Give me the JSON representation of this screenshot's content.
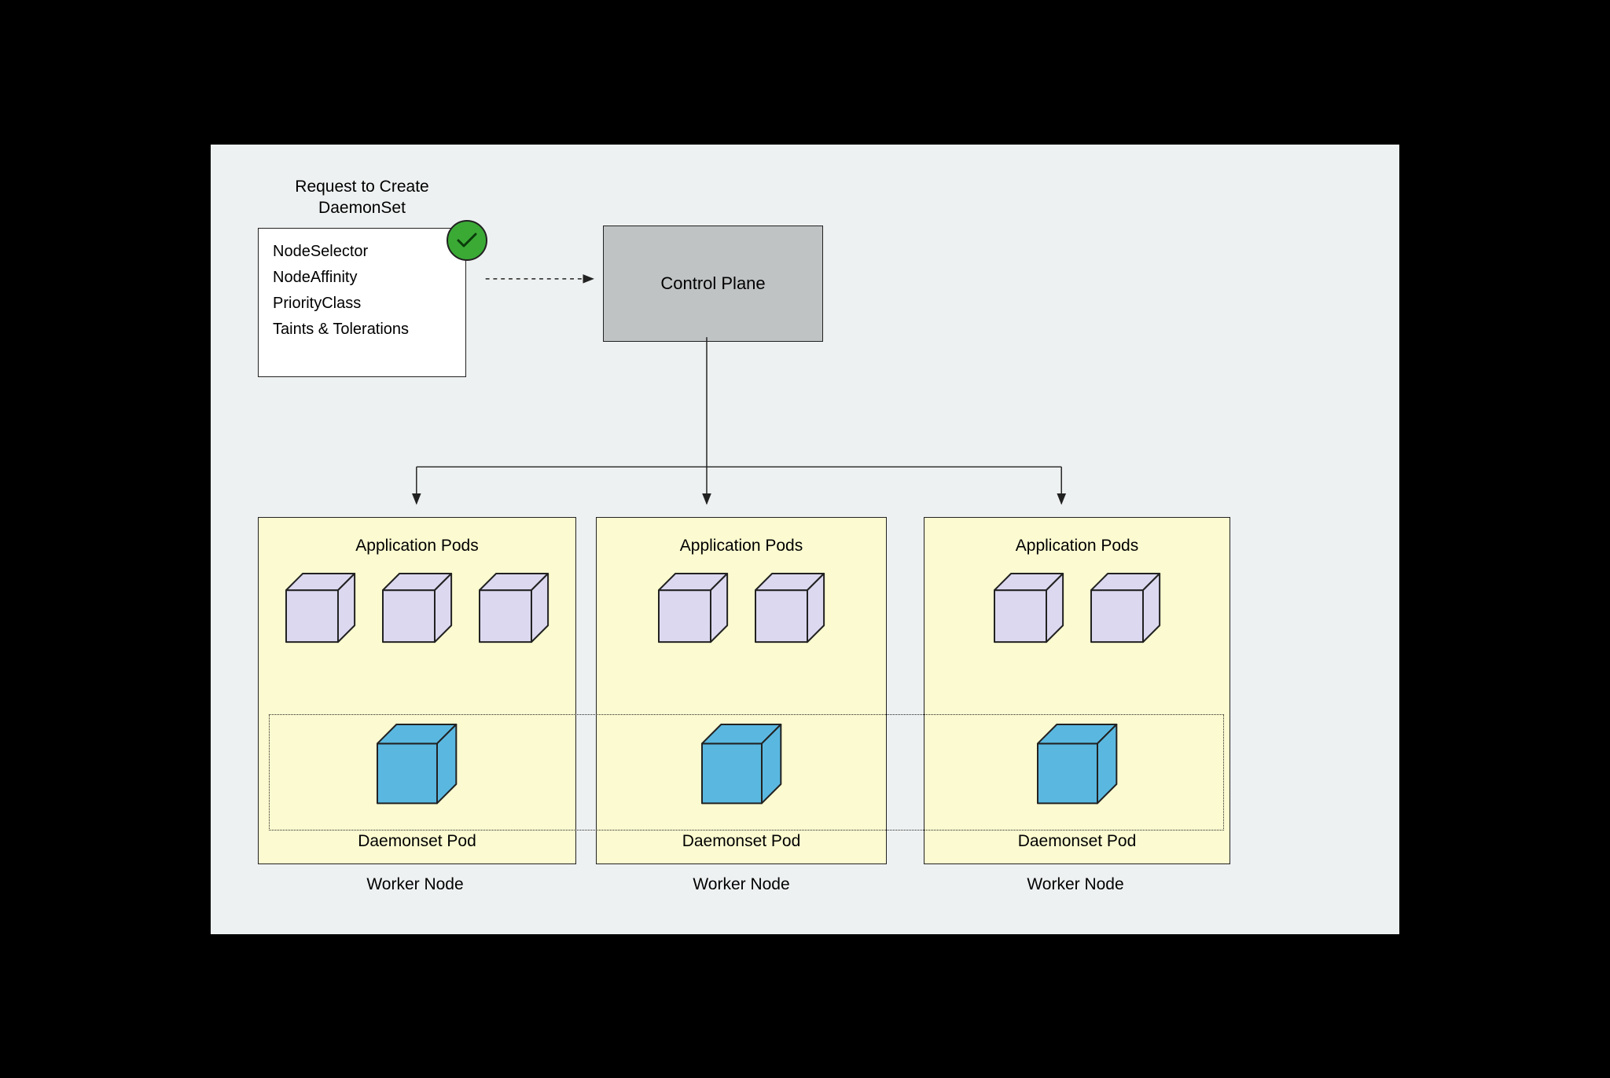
{
  "request": {
    "title": "Request to Create\nDaemonSet",
    "items": [
      "NodeSelector",
      "NodeAffinity",
      "PriorityClass",
      "Taints & Tolerations"
    ]
  },
  "control_plane": "Control Plane",
  "worker_nodes": [
    {
      "app_label": "Application Pods",
      "app_cube_count": 3,
      "ds_label": "Daemonset Pod",
      "node_label": "Worker Node"
    },
    {
      "app_label": "Application Pods",
      "app_cube_count": 2,
      "ds_label": "Daemonset Pod",
      "node_label": "Worker Node"
    },
    {
      "app_label": "Application Pods",
      "app_cube_count": 2,
      "ds_label": "Daemonset Pod",
      "node_label": "Worker Node"
    }
  ],
  "colors": {
    "app_cube": "#dcd8f0",
    "ds_cube": "#5ab8e0",
    "badge": "#3aaa35",
    "node_bg": "#fbfad0",
    "canvas_bg": "#eef1f1",
    "control_bg": "#c0c3c4"
  }
}
